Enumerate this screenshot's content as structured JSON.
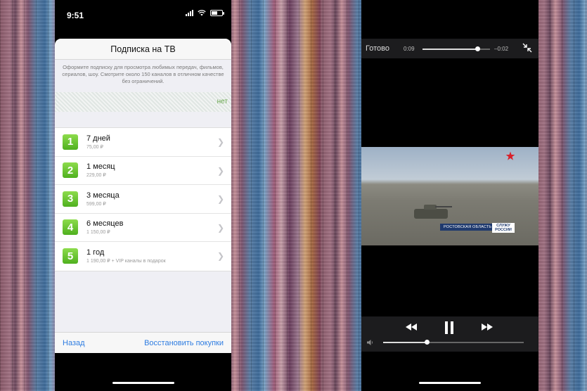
{
  "left_phone": {
    "status": {
      "time": "9:51"
    },
    "sheet": {
      "title": "Подписка на ТВ",
      "description": "Оформите подписку для просмотра любимых передач, фильмов, сериалов, шоу. Смотрите около 150 каналов в отличном качестве без ограничений.",
      "banner_text": "нет",
      "plans": [
        {
          "num": "1",
          "name": "7 дней",
          "price": "75,00 ₽"
        },
        {
          "num": "2",
          "name": "1 месяц",
          "price": "229,00 ₽"
        },
        {
          "num": "3",
          "name": "3 месяца",
          "price": "599,00 ₽"
        },
        {
          "num": "4",
          "name": "6 месяцев",
          "price": "1 150,00 ₽"
        },
        {
          "num": "5",
          "name": "1 год",
          "price": "1 190,00 ₽ + VIP каналы в подарок"
        }
      ],
      "back_label": "Назад",
      "restore_label": "Восстановить покупки"
    }
  },
  "right_phone": {
    "done_label": "Готово",
    "elapsed": "0:09",
    "remaining": "–0:02",
    "progress": 0.82,
    "volume": 0.31,
    "video_overlay": {
      "location": "РОСТОВСКАЯ ОБЛАСТЬ",
      "channel_line1": "СЛУЖУ",
      "channel_line2": "РОССИИ"
    }
  },
  "colors": {
    "accent": "#2f7de1",
    "plan_green": "#5cbf2a",
    "banner_green": "#6aa84f"
  }
}
